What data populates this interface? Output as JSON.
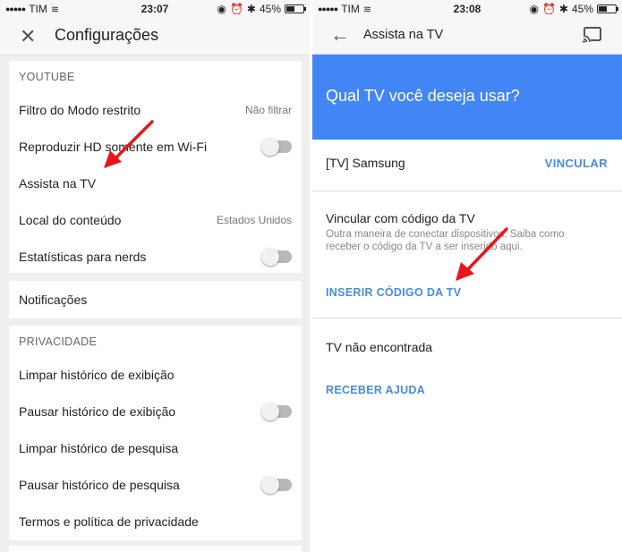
{
  "left": {
    "status": {
      "carrier": "TIM",
      "time": "23:07",
      "battery": "45%",
      "battery_level": 0.45
    },
    "appbar": {
      "title": "Configurações"
    },
    "youtube": {
      "header": "YOUTUBE",
      "rows": [
        {
          "label": "Filtro do Modo restrito",
          "value": "Não filtrar"
        },
        {
          "label": "Reproduzir HD somente em Wi-Fi"
        },
        {
          "label": "Assista na TV"
        },
        {
          "label": "Local do conteúdo",
          "value": "Estados Unidos"
        },
        {
          "label": "Estatísticas para nerds"
        }
      ]
    },
    "notifications": {
      "label": "Notificações"
    },
    "privacy": {
      "header": "PRIVACIDADE",
      "rows": [
        {
          "label": "Limpar histórico de exibição"
        },
        {
          "label": "Pausar histórico de exibição"
        },
        {
          "label": "Limpar histórico de pesquisa"
        },
        {
          "label": "Pausar histórico de pesquisa"
        },
        {
          "label": "Termos e política de privacidade"
        }
      ]
    }
  },
  "right": {
    "status": {
      "carrier": "TIM",
      "time": "23:08",
      "battery": "45%",
      "battery_level": 0.45
    },
    "appbar": {
      "title": "Assista na TV"
    },
    "banner": {
      "question": "Qual TV você deseja usar?"
    },
    "device": {
      "name": "[TV] Samsung",
      "action": "VINCULAR"
    },
    "code": {
      "heading": "Vincular com código da TV",
      "description": "Outra maneira de conectar dispositivos. Saiba como receber o código da TV a ser inserido aqui.",
      "action": "INSERIR CÓDIGO DA TV"
    },
    "notfound": {
      "heading": "TV não encontrada",
      "action": "RECEBER AJUDA"
    }
  },
  "colors": {
    "accent": "#4285f4",
    "link": "#4a8bdc",
    "annotation_arrow": "#e8161b"
  }
}
